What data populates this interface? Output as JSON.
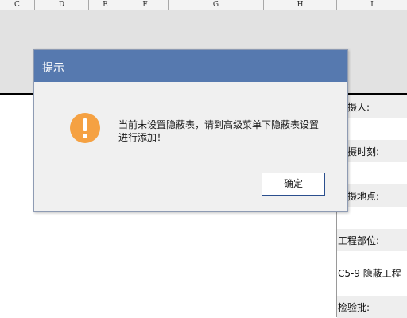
{
  "columns": [
    "C",
    "D",
    "E",
    "F",
    "G",
    "H",
    "I"
  ],
  "sheet": {
    "labels": [
      "拍摄人:",
      "拍摄时刻:",
      "拍摄地点:",
      "工程部位:",
      "C5-9 隐蔽工程",
      "检验批:"
    ]
  },
  "dialog": {
    "title": "提示",
    "message_line1": "当前未设置隐蔽表，请到高级菜单下隐蔽表设置",
    "message_line2": "进行添加！",
    "ok_label": "确定",
    "icon": "warning-icon",
    "icon_color": "#f5a142",
    "title_bar_color": "#5679af"
  }
}
